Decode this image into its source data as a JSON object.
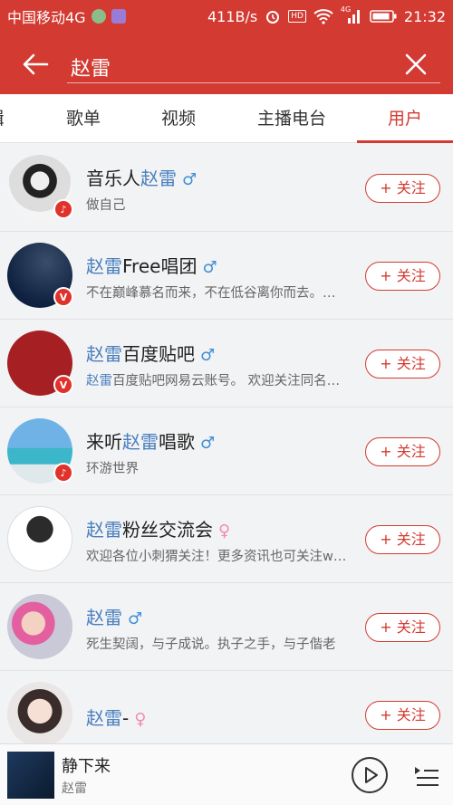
{
  "status_bar": {
    "carrier": "中国移动4G",
    "speed": "411B/s",
    "hd": "HD",
    "network": "4G",
    "time": "21:32"
  },
  "search": {
    "query": "赵雷"
  },
  "tabs": [
    {
      "label": "辑",
      "active": false
    },
    {
      "label": "歌单",
      "active": false
    },
    {
      "label": "视频",
      "active": false
    },
    {
      "label": "主播电台",
      "active": false
    },
    {
      "label": "用户",
      "active": true
    }
  ],
  "users": [
    {
      "name_pre": "音乐人",
      "name_hl": "赵雷",
      "name_post": "",
      "gender": "male",
      "desc_hl": "",
      "desc": "做自己",
      "badge": "♪",
      "follow": "+ 关注"
    },
    {
      "name_pre": "",
      "name_hl": "赵雷",
      "name_post": "Free唱团",
      "gender": "male",
      "desc_hl": "",
      "desc": "不在巅峰慕名而来，不在低谷离你而去。…",
      "badge": "V",
      "follow": "+ 关注"
    },
    {
      "name_pre": "",
      "name_hl": "赵雷",
      "name_post": "百度贴吧",
      "gender": "male",
      "desc_hl": "赵雷",
      "desc": "百度贴吧网易云账号。 欢迎关注同名…",
      "badge": "V",
      "follow": "+ 关注"
    },
    {
      "name_pre": "来听",
      "name_hl": "赵雷",
      "name_post": "唱歌",
      "gender": "male",
      "desc_hl": "",
      "desc": "环游世界",
      "badge": "♪",
      "follow": "+ 关注"
    },
    {
      "name_pre": "",
      "name_hl": "赵雷",
      "name_post": "粉丝交流会",
      "gender": "female",
      "desc_hl": "",
      "desc": "欢迎各位小刺猬关注！更多资讯也可关注w…",
      "badge": "",
      "follow": "+ 关注"
    },
    {
      "name_pre": "",
      "name_hl": "赵雷",
      "name_post": "",
      "gender": "male",
      "desc_hl": "",
      "desc": "死生契阔，与子成说。执子之手，与子偕老",
      "badge": "",
      "follow": "+ 关注"
    },
    {
      "name_pre": "",
      "name_hl": "赵雷",
      "name_post": "-",
      "gender": "female",
      "desc_hl": "",
      "desc": "",
      "badge": "",
      "follow": "+ 关注"
    }
  ],
  "player": {
    "song": "静下来",
    "artist": "赵雷"
  },
  "colors": {
    "accent": "#d33a31",
    "highlight": "#4a7fbf",
    "male": "#3f8fd8",
    "female": "#f08bb0"
  }
}
